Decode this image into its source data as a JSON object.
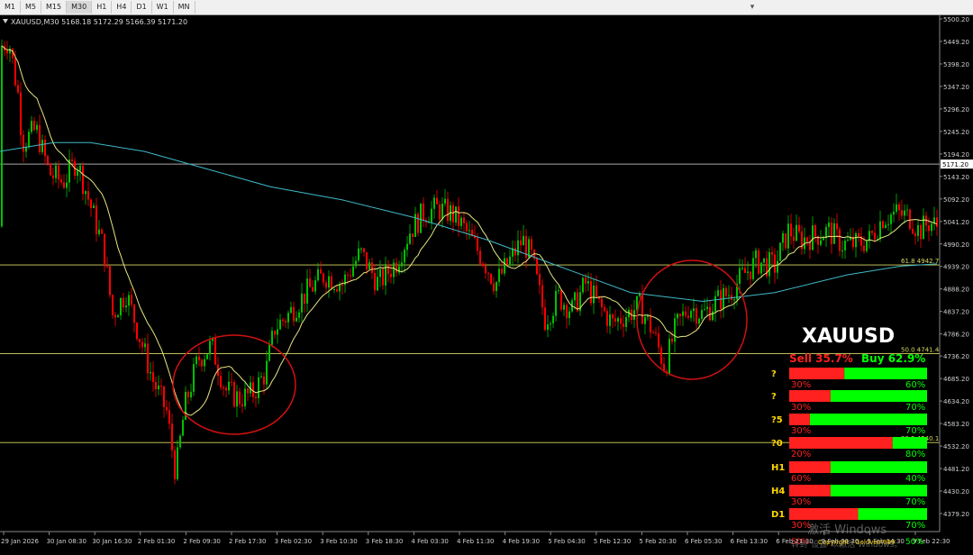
{
  "toolbar": {
    "timeframes": [
      "M1",
      "M5",
      "M15",
      "M30",
      "H1",
      "H4",
      "D1",
      "W1",
      "MN"
    ],
    "active_timeframe": "M30"
  },
  "chart_info": {
    "header": "XAUUSD,M30  5168.18 5172.29 5166.39 5171.20",
    "current_price": "5171.20"
  },
  "price_axis": {
    "ticks": [
      "5500.20",
      "5449.20",
      "5398.20",
      "5347.20",
      "5296.20",
      "5245.20",
      "5194.20",
      "5143.20",
      "5092.20",
      "5041.20",
      "4990.20",
      "4939.20",
      "4888.20",
      "4837.20",
      "4786.20",
      "4736.20",
      "4685.20",
      "4634.20",
      "4583.20",
      "4532.20",
      "4481.20",
      "4430.20",
      "4379.20"
    ],
    "min": 4379.2,
    "max": 5500.2
  },
  "time_axis": {
    "labels": [
      "29 Jan 2026",
      "30 Jan 08:30",
      "30 Jan 16:30",
      "2 Feb 01:30",
      "2 Feb 09:30",
      "2 Feb 17:30",
      "3 Feb 02:30",
      "3 Feb 10:30",
      "3 Feb 18:30",
      "4 Feb 03:30",
      "4 Feb 11:30",
      "4 Feb 19:30",
      "5 Feb 04:30",
      "5 Feb 12:30",
      "5 Feb 20:30",
      "6 Feb 05:30",
      "6 Feb 13:30",
      "6 Feb 21:30",
      "9 Feb 06:30",
      "9 Feb 14:30",
      "9 Feb 22:30"
    ]
  },
  "levels": {
    "fib_61_8_label": "61.8 4942.73",
    "fib_50_label": "50.0 4741.44",
    "fib_low_label": "38.2 4540.15"
  },
  "panel": {
    "symbol": "XAUUSD",
    "sell_label": "Sell 35.7%",
    "buy_label": "Buy 62.9%",
    "copyright": "Copyright - Goldvein999",
    "rows": [
      {
        "label": "?",
        "sell_pct": "30%",
        "buy_pct": "60%",
        "sell_frac": 0.4
      },
      {
        "label": "?",
        "sell_pct": "30%",
        "buy_pct": "70%",
        "sell_frac": 0.3
      },
      {
        "label": "?5",
        "sell_pct": "30%",
        "buy_pct": "70%",
        "sell_frac": 0.15
      },
      {
        "label": "?0",
        "sell_pct": "20%",
        "buy_pct": "80%",
        "sell_frac": 0.75
      },
      {
        "label": "H1",
        "sell_pct": "60%",
        "buy_pct": "40%",
        "sell_frac": 0.3
      },
      {
        "label": "H4",
        "sell_pct": "30%",
        "buy_pct": "70%",
        "sell_frac": 0.3
      },
      {
        "label": "D1",
        "sell_pct": "30%",
        "buy_pct": "70%",
        "sell_frac": 0.5
      }
    ],
    "last_sell_pct": "50%",
    "last_buy_pct": "50%"
  },
  "watermark": {
    "line1": "激活 Windows",
    "line2": "转到\"设置\"以激活 Windows。"
  },
  "colors": {
    "bull": "#00c000",
    "bear": "#ff0000",
    "ma_fast": "#e6e680",
    "ma_slow": "#40b8c8",
    "level_line": "#d8d860",
    "sell": "#ff2020",
    "buy": "#00ff00"
  }
}
